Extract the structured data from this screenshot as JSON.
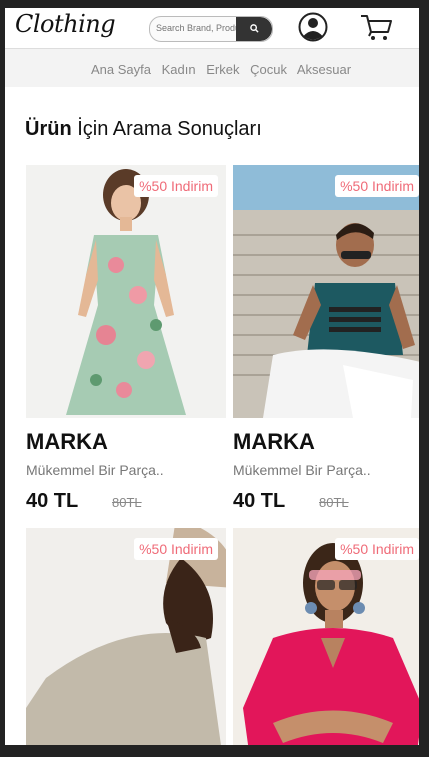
{
  "header": {
    "logo": "Clothing",
    "search_placeholder": "Search Brand, Product",
    "user_icon": "user-circle-icon",
    "cart_icon": "shopping-cart-icon"
  },
  "nav": {
    "items": [
      "Ana Sayfa",
      "Kadın",
      "Erkek",
      "Çocuk",
      "Aksesuar"
    ]
  },
  "results": {
    "title_bold": "Ürün",
    "title_rest": " İçin Arama Sonuçları"
  },
  "products": [
    {
      "badge": "%50 Indirim",
      "brand": "MARKA",
      "desc": "Mükemmel Bir Parça..",
      "price": "40 TL",
      "old_price": "80TL"
    },
    {
      "badge": "%50 Indirim",
      "brand": "MARKA",
      "desc": "Mükemmel Bir Parça..",
      "price": "40 TL",
      "old_price": "80TL"
    },
    {
      "badge": "%50 Indirim"
    },
    {
      "badge": "%50 Indirim"
    }
  ],
  "colors": {
    "accent": "#ef6b78",
    "search_button": "#333333",
    "nav_background": "#f3f3f3"
  }
}
